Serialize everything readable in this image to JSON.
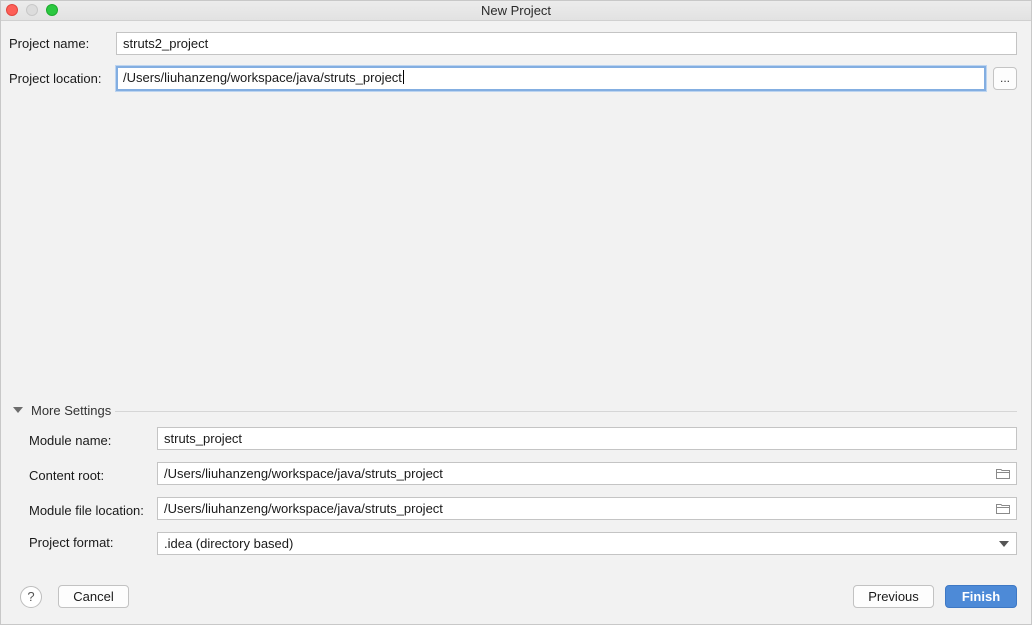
{
  "window": {
    "title": "New Project"
  },
  "project": {
    "name_label": "Project name:",
    "name_value": "struts2_project",
    "location_label": "Project location:",
    "location_value": "/Users/liuhanzeng/workspace/java/struts_project",
    "browse_label": "..."
  },
  "more_settings": {
    "title": "More Settings",
    "expanded": true,
    "module_name_label": "Module name:",
    "module_name_value": "struts_project",
    "content_root_label": "Content root:",
    "content_root_value": "/Users/liuhanzeng/workspace/java/struts_project",
    "module_file_label": "Module file location:",
    "module_file_value": "/Users/liuhanzeng/workspace/java/struts_project",
    "format_label": "Project format:",
    "format_value": ".idea (directory based)"
  },
  "footer": {
    "help_label": "?",
    "cancel_label": "Cancel",
    "previous_label": "Previous",
    "finish_label": "Finish"
  },
  "colors": {
    "primary_button": "#4d8ad7",
    "focus_ring": "#83aee1",
    "close": "#fd5f57",
    "maximize": "#2bc840"
  },
  "icons": {
    "section_toggle": "triangle-down-icon",
    "folder": "folder-icon",
    "dropdown": "chevron-down-icon"
  }
}
